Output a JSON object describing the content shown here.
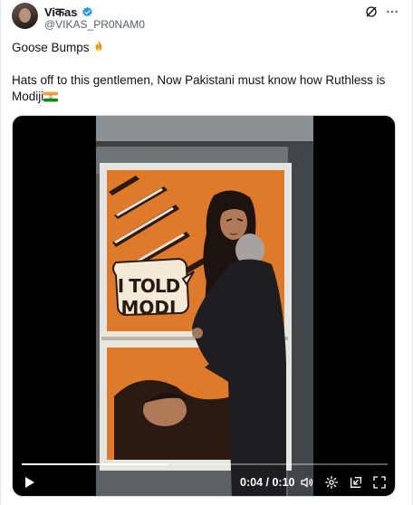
{
  "author": {
    "display_name": "Viकas",
    "handle": "@VIKAS_PR0NAM0"
  },
  "tweet": {
    "line1": "Goose Bumps",
    "line1_emoji": "fire",
    "line2": "Hats off to this gentlemen, Now Pakistani must know how Ruthless is Modiji",
    "line2_emoji": "india-flag"
  },
  "video": {
    "poster_speech": "I TOLD MODI",
    "time_current": "0:04",
    "time_total": "0:10",
    "progress": 0.4
  },
  "colors": {
    "verified": "#1d9bf0",
    "poster_bg": "#e07a2b",
    "poster_dark": "#2a1a12"
  },
  "icons": [
    "grok-icon",
    "more-icon",
    "verified-icon",
    "play-icon",
    "volume-icon",
    "settings-icon",
    "pip-icon",
    "fullscreen-icon"
  ]
}
